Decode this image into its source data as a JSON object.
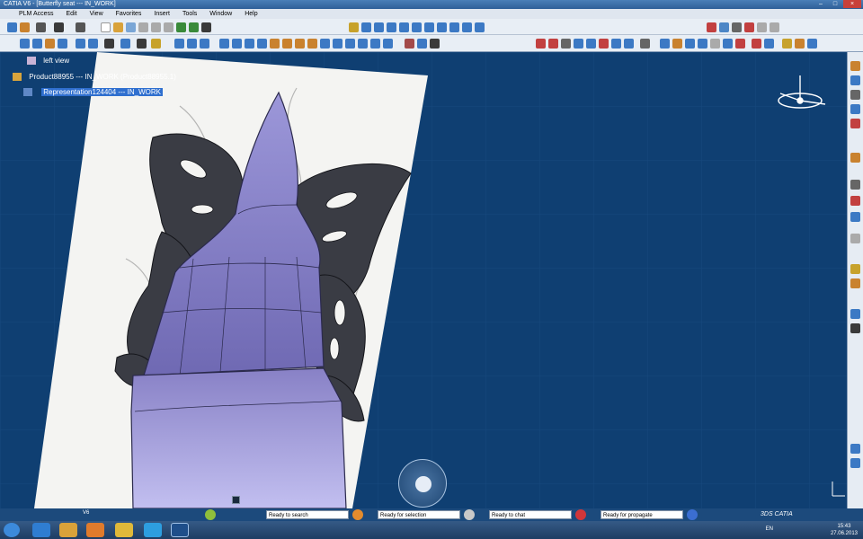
{
  "window": {
    "title": "CATIA V6 - [Butterfly seat --- IN_WORK]",
    "controls": [
      "–",
      "□",
      "×"
    ]
  },
  "menu": [
    "PLM Access",
    "Edit",
    "View",
    "Favorites",
    "Insert",
    "Tools",
    "Window",
    "Help"
  ],
  "tree": {
    "items": [
      {
        "label": "left view",
        "selected": false
      },
      {
        "label": "Product88955 --- IN_WORK (Product88955.1)",
        "selected": false
      },
      {
        "label": "Representation124404 --- IN_WORK",
        "selected": true
      }
    ]
  },
  "status": {
    "fields": [
      "Ready to search",
      "Ready for selection",
      "Ready to chat",
      "Ready for propagate"
    ],
    "left_label": "V6"
  },
  "brand": "3DS CATIA",
  "taskbar": {
    "lang": "EN",
    "time": "15:43",
    "date": "27.06.2013"
  },
  "colors": {
    "viewport_bg": "#0f3f72",
    "seat_top": "#8c86c9",
    "butterfly": "#3b3d45",
    "selection": "#2f6fcf"
  }
}
